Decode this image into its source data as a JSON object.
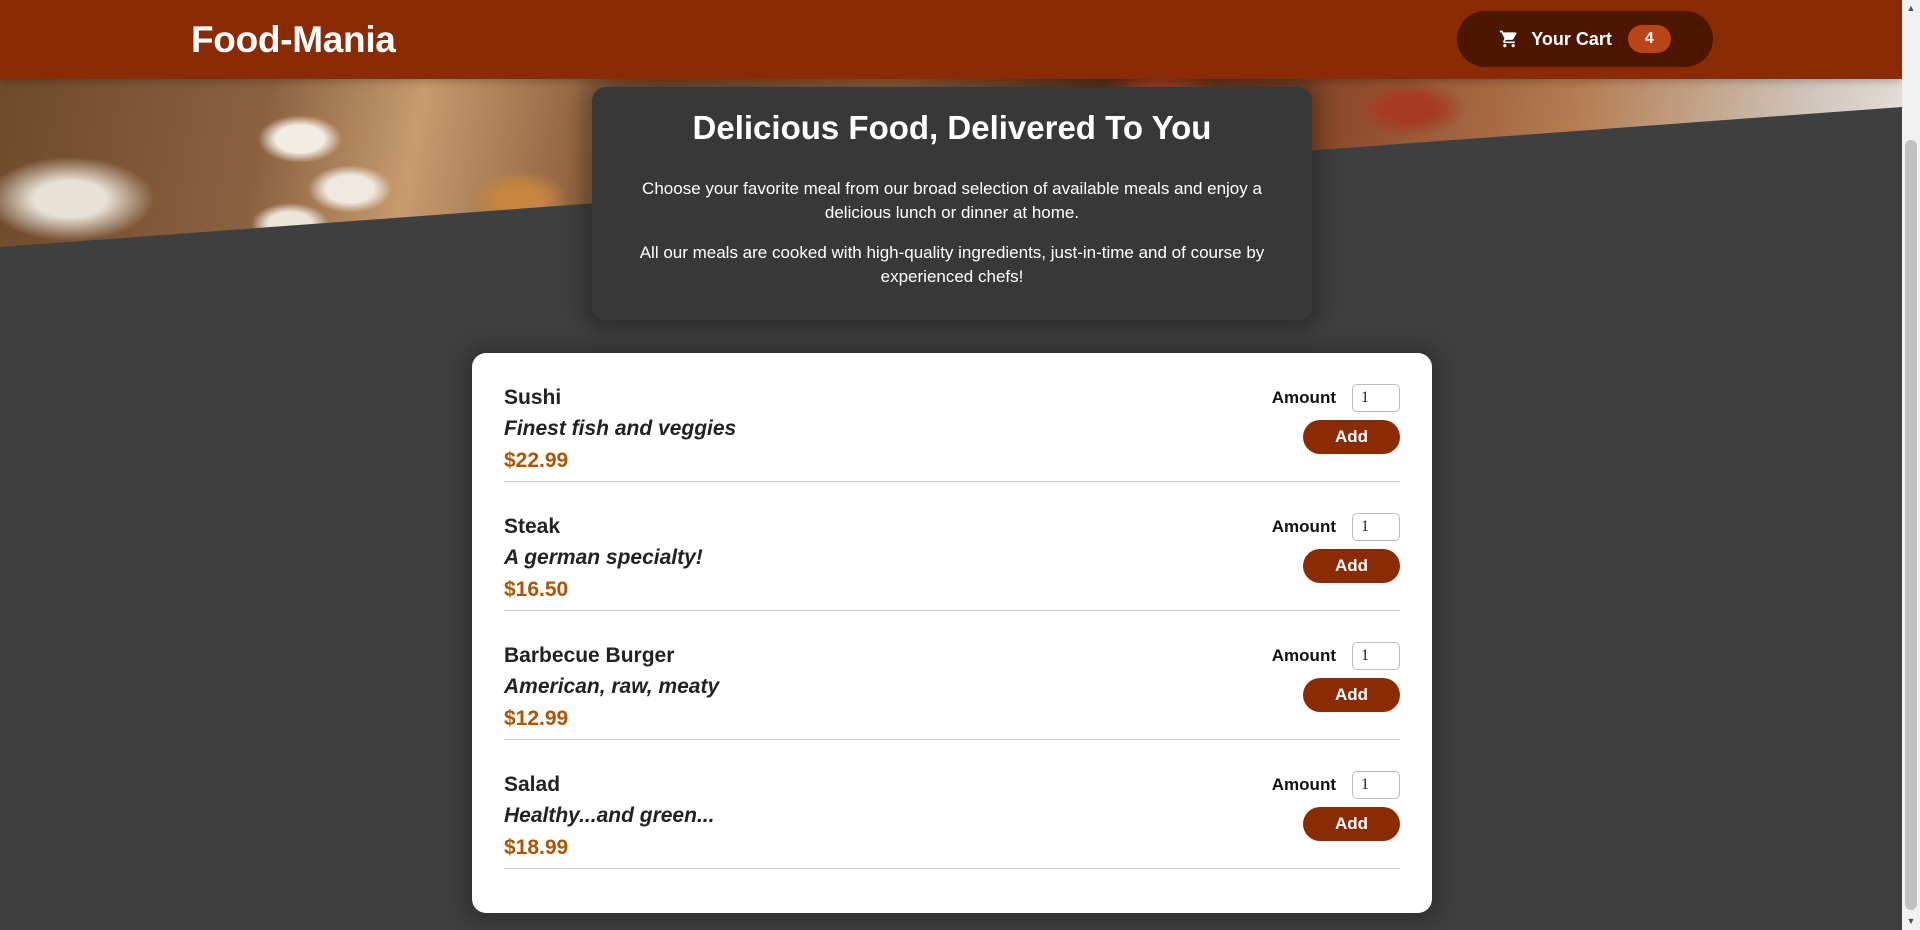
{
  "header": {
    "brand": "Food-Mania",
    "cart": {
      "label": "Your Cart",
      "count": "4",
      "icon": "cart-icon"
    }
  },
  "summary": {
    "title": "Delicious Food, Delivered To You",
    "paragraph1": "Choose your favorite meal from our broad selection of available meals and enjoy a delicious lunch or dinner at home.",
    "paragraph2": "All our meals are cooked with high-quality ingredients, just-in-time and of course by experienced chefs!"
  },
  "meals": [
    {
      "name": "Sushi",
      "description": "Finest fish and veggies",
      "price": "$22.99",
      "amount_label": "Amount",
      "amount_value": "1",
      "add_label": "Add"
    },
    {
      "name": "Steak",
      "description": "A german specialty!",
      "price": "$16.50",
      "amount_label": "Amount",
      "amount_value": "1",
      "add_label": "Add"
    },
    {
      "name": "Barbecue Burger",
      "description": "American, raw, meaty",
      "price": "$12.99",
      "amount_label": "Amount",
      "amount_value": "1",
      "add_label": "Add"
    },
    {
      "name": "Salad",
      "description": "Healthy...and green...",
      "price": "$18.99",
      "amount_label": "Amount",
      "amount_value": "1",
      "add_label": "Add"
    }
  ],
  "colors": {
    "header": "#8a2b06",
    "cart_button": "#4d1601",
    "badge": "#b94517",
    "price": "#ad5502",
    "background": "#3f3f3f"
  }
}
